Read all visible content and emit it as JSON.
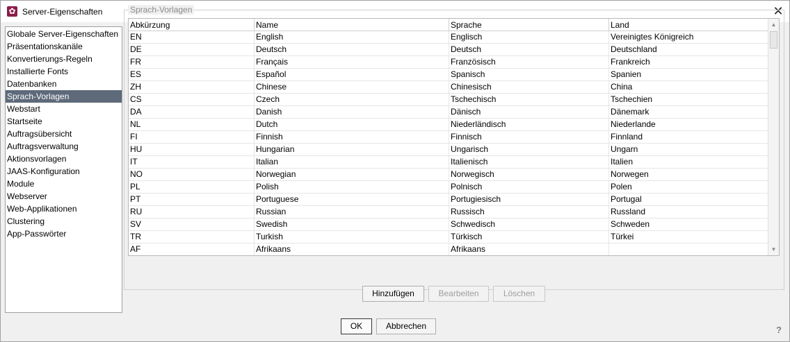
{
  "window": {
    "title": "Server-Eigenschaften",
    "close_glyph": "✕"
  },
  "nav": {
    "items": [
      {
        "label": "Globale Server-Eigenschaften",
        "selected": false
      },
      {
        "label": "Präsentationskanäle",
        "selected": false
      },
      {
        "label": "Konvertierungs-Regeln",
        "selected": false
      },
      {
        "label": "Installierte Fonts",
        "selected": false
      },
      {
        "label": "Datenbanken",
        "selected": false
      },
      {
        "label": "Sprach-Vorlagen",
        "selected": true
      },
      {
        "label": "Webstart",
        "selected": false
      },
      {
        "label": "Startseite",
        "selected": false
      },
      {
        "label": "Auftragsübersicht",
        "selected": false
      },
      {
        "label": "Auftragsverwaltung",
        "selected": false
      },
      {
        "label": "Aktionsvorlagen",
        "selected": false
      },
      {
        "label": "JAAS-Konfiguration",
        "selected": false
      },
      {
        "label": "Module",
        "selected": false
      },
      {
        "label": "Webserver",
        "selected": false
      },
      {
        "label": "Web-Applikationen",
        "selected": false
      },
      {
        "label": "Clustering",
        "selected": false
      },
      {
        "label": "App-Passwörter",
        "selected": false
      }
    ]
  },
  "panel": {
    "title": "Sprach-Vorlagen",
    "columns": [
      "Abkürzung",
      "Name",
      "Sprache",
      "Land"
    ],
    "rows": [
      [
        "EN",
        "English",
        "Englisch",
        "Vereinigtes Königreich"
      ],
      [
        "DE",
        "Deutsch",
        "Deutsch",
        "Deutschland"
      ],
      [
        "FR",
        "Français",
        "Französisch",
        "Frankreich"
      ],
      [
        "ES",
        "Español",
        "Spanisch",
        "Spanien"
      ],
      [
        "ZH",
        "Chinese",
        "Chinesisch",
        "China"
      ],
      [
        "CS",
        "Czech",
        "Tschechisch",
        "Tschechien"
      ],
      [
        "DA",
        "Danish",
        "Dänisch",
        "Dänemark"
      ],
      [
        "NL",
        "Dutch",
        "Niederländisch",
        "Niederlande"
      ],
      [
        "FI",
        "Finnish",
        "Finnisch",
        "Finnland"
      ],
      [
        "HU",
        "Hungarian",
        "Ungarisch",
        "Ungarn"
      ],
      [
        "IT",
        "Italian",
        "Italienisch",
        "Italien"
      ],
      [
        "NO",
        "Norwegian",
        "Norwegisch",
        "Norwegen"
      ],
      [
        "PL",
        "Polish",
        "Polnisch",
        "Polen"
      ],
      [
        "PT",
        "Portuguese",
        "Portugiesisch",
        "Portugal"
      ],
      [
        "RU",
        "Russian",
        "Russisch",
        "Russland"
      ],
      [
        "SV",
        "Swedish",
        "Schwedisch",
        "Schweden"
      ],
      [
        "TR",
        "Turkish",
        "Türkisch",
        "Türkei"
      ],
      [
        "AF",
        "Afrikaans",
        "Afrikaans",
        ""
      ]
    ],
    "buttons": {
      "add": "Hinzufügen",
      "edit": "Bearbeiten",
      "delete": "Löschen"
    }
  },
  "footer": {
    "ok": "OK",
    "cancel": "Abbrechen",
    "help_glyph": "?"
  },
  "colors": {
    "selection": "#5e6a7a",
    "app_icon": "#8b1c4a"
  }
}
